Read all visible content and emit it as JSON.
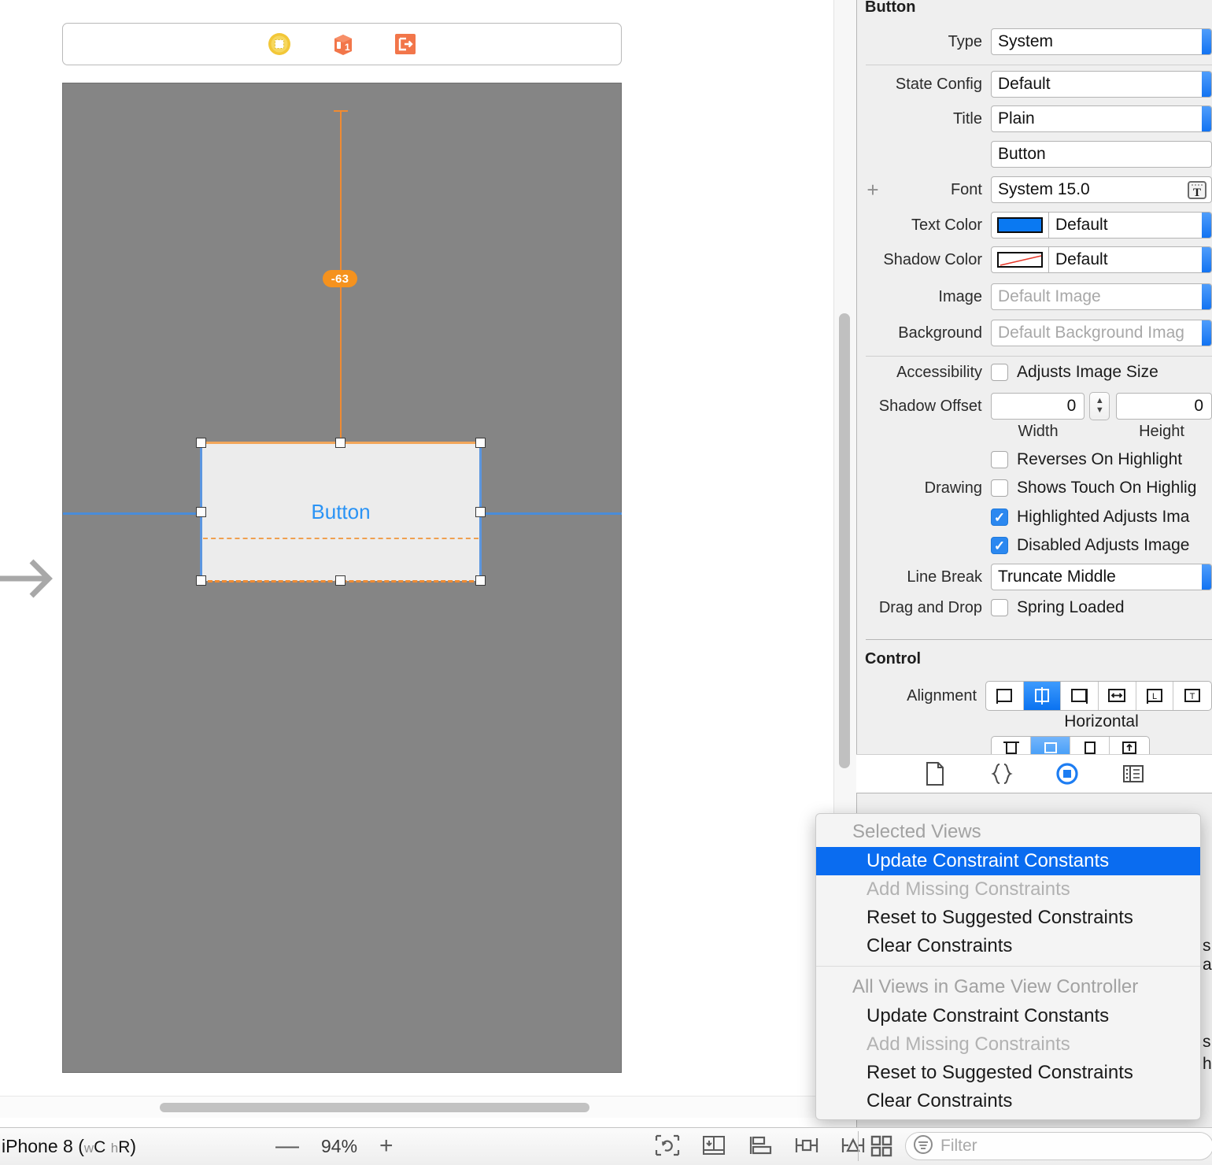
{
  "canvas": {
    "scene_dock": [
      {
        "name": "view-controller-icon",
        "title": "View Controller"
      },
      {
        "name": "first-responder-icon",
        "title": "First Responder"
      },
      {
        "name": "exit-icon",
        "title": "Exit"
      }
    ],
    "button": {
      "title": "Button"
    },
    "constraint_badge": "-63"
  },
  "bottom_bar": {
    "device": "iPhone 8",
    "trait_w_prefix": "w",
    "trait_w": "C",
    "trait_h_prefix": "h",
    "trait_h": "R",
    "zoom_out": "—",
    "zoom_value": "94%",
    "zoom_in": "+",
    "tools": [
      {
        "name": "update-frames-icon",
        "label": "Update Frames"
      },
      {
        "name": "embed-in-icon",
        "label": "Embed In"
      },
      {
        "name": "align-icon",
        "label": "Align"
      },
      {
        "name": "add-new-constraints-icon",
        "label": "Add New Constraints"
      },
      {
        "name": "resolve-auto-layout-issues-icon",
        "label": "Resolve Auto Layout Issues"
      }
    ],
    "grid_button": "document-outline-icon",
    "filter_placeholder": "Filter"
  },
  "inspector": {
    "section_button": "Button",
    "rows": {
      "type_label": "Type",
      "type_value": "System",
      "state_config_label": "State Config",
      "state_config_value": "Default",
      "title_label": "Title",
      "title_value": "Plain",
      "title_text_value": "Button",
      "font_label": "Font",
      "font_value": "System 15.0",
      "font_add": "+",
      "text_color_label": "Text Color",
      "text_color_value": "Default",
      "text_color_hex": "#0a79f2",
      "shadow_color_label": "Shadow Color",
      "shadow_color_value": "Default",
      "shadow_color_hex": "#ffffff",
      "image_label": "Image",
      "image_placeholder": "Default Image",
      "background_label": "Background",
      "background_placeholder": "Default Background Imag",
      "accessibility_label": "Accessibility",
      "adjusts_image_size": "Adjusts Image Size",
      "shadow_offset_label": "Shadow Offset",
      "shadow_offset_width": "0",
      "shadow_offset_height": "0",
      "width_sub": "Width",
      "height_sub": "Height",
      "reverses_on_highlight": "Reverses On Highlight",
      "drawing_label": "Drawing",
      "shows_touch_on_highlight": "Shows Touch On Highlig",
      "highlighted_adjusts_image": "Highlighted Adjusts Ima",
      "disabled_adjusts_image": "Disabled Adjusts Image",
      "line_break_label": "Line Break",
      "line_break_value": "Truncate Middle",
      "drag_and_drop_label": "Drag and Drop",
      "spring_loaded": "Spring Loaded"
    },
    "section_control": "Control",
    "control": {
      "alignment_label": "Alignment",
      "horizontal_caption": "Horizontal"
    },
    "tabs": [
      {
        "name": "file-inspector-tab",
        "label": "File Inspector"
      },
      {
        "name": "quick-help-tab",
        "label": "Quick Help"
      },
      {
        "name": "identity-inspector-tab",
        "label": "Identity Inspector"
      },
      {
        "name": "attributes-inspector-tab",
        "label": "Attributes Inspector"
      }
    ],
    "obscured_fragments": [
      "s",
      "a",
      "s",
      "h"
    ]
  },
  "context_menu": {
    "group_selected": "Selected Views",
    "selected_items": [
      {
        "label": "Update Constraint Constants",
        "state": "highlighted"
      },
      {
        "label": "Add Missing Constraints",
        "state": "disabled"
      },
      {
        "label": "Reset to Suggested Constraints",
        "state": "normal"
      },
      {
        "label": "Clear Constraints",
        "state": "normal"
      }
    ],
    "group_all": "All Views in Game View Controller",
    "all_items": [
      {
        "label": "Update Constraint Constants",
        "state": "normal"
      },
      {
        "label": "Add Missing Constraints",
        "state": "disabled"
      },
      {
        "label": "Reset to Suggested Constraints",
        "state": "normal"
      },
      {
        "label": "Clear Constraints",
        "state": "normal"
      }
    ]
  }
}
